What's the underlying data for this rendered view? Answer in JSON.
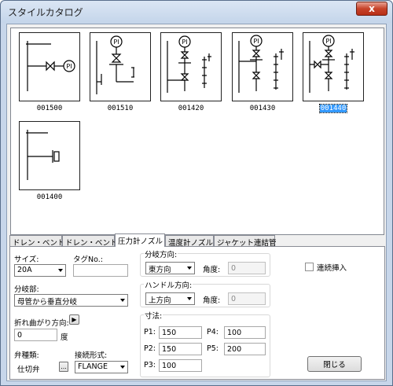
{
  "window": {
    "title": "スタイルカタログ",
    "close_glyph": "x"
  },
  "catalog": {
    "items": [
      {
        "code": "001500",
        "selected": false
      },
      {
        "code": "001510",
        "selected": false
      },
      {
        "code": "001420",
        "selected": false
      },
      {
        "code": "001430",
        "selected": false
      },
      {
        "code": "001440",
        "selected": true
      },
      {
        "code": "001400",
        "selected": false
      }
    ],
    "gauge_symbol": "PI"
  },
  "tabs": [
    {
      "label": "ドレン・ベント1",
      "active": false
    },
    {
      "label": "ドレン・ベント2",
      "active": false
    },
    {
      "label": "圧力計ノズル",
      "active": true
    },
    {
      "label": "温度計ノズル",
      "active": false
    },
    {
      "label": "ジャケット連結管",
      "active": false
    }
  ],
  "form": {
    "size_label": "サイズ:",
    "size_value": "20A",
    "tag_label": "タグNo.:",
    "tag_value": "",
    "branch_part_label": "分岐部:",
    "branch_part_value": "母管から垂直分岐",
    "bend_dir_label": "折れ曲がり方向:",
    "bend_dir_button": "▶",
    "bend_angle_value": "0",
    "degree_unit": "度",
    "valve_type_label": "弁種類:",
    "valve_type_value": "仕切弁",
    "valve_browse_label": "...",
    "connection_label": "接続形式:",
    "connection_value": "FLANGE"
  },
  "branch_direction": {
    "group_label": "分岐方向:",
    "value": "東方向",
    "angle_label": "角度:",
    "angle_value": "0"
  },
  "handle_direction": {
    "group_label": "ハンドル方向:",
    "value": "上方向",
    "angle_label": "角度:",
    "angle_value": "0"
  },
  "dimensions": {
    "group_label": "寸法:",
    "p1_label": "P1:",
    "p1_value": "150",
    "p2_label": "P2:",
    "p2_value": "150",
    "p3_label": "P3:",
    "p3_value": "100",
    "p4_label": "P4:",
    "p4_value": "100",
    "p5_label": "P5:",
    "p5_value": "200"
  },
  "continuous_insert": {
    "label": "連続挿入",
    "checked": false
  },
  "close_button_label": "閉じる"
}
